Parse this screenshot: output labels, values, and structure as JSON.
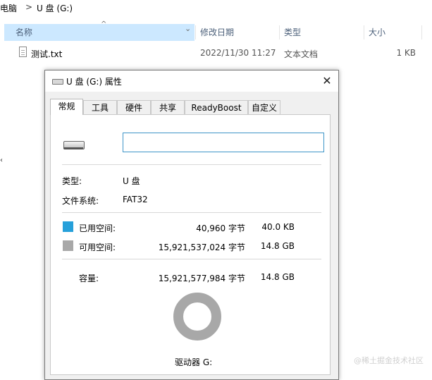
{
  "breadcrumb": {
    "parent": "电脑",
    "separator": ">",
    "current": "U 盘 (G:)"
  },
  "columns": {
    "name": "名称",
    "modified": "修改日期",
    "type": "类型",
    "size": "大小"
  },
  "files": [
    {
      "name": "测试.txt",
      "modified": "2022/11/30 11:27",
      "type": "文本文档",
      "size": "1 KB"
    }
  ],
  "dialog": {
    "title": "U 盘 (G:) 属性",
    "close_glyph": "✕",
    "tabs": [
      "常规",
      "工具",
      "硬件",
      "共享",
      "ReadyBoost",
      "自定义"
    ],
    "active_tab": "常规",
    "name_value": "",
    "type_label": "类型:",
    "type_value": "U 盘",
    "fs_label": "文件系统:",
    "fs_value": "FAT32",
    "used_label": "已用空间:",
    "used_bytes": "40,960 字节",
    "used_size": "40.0 KB",
    "free_label": "可用空间:",
    "free_bytes": "15,921,537,024 字节",
    "free_size": "14.8 GB",
    "capacity_label": "容量:",
    "capacity_bytes": "15,921,577,984 字节",
    "capacity_size": "14.8 GB",
    "drive_label": "驱动器 G:"
  },
  "colors": {
    "used": "#26a0da",
    "free": "#a8a8a8",
    "selection": "#cce8ff"
  },
  "watermark": "@稀土掘金技术社区"
}
